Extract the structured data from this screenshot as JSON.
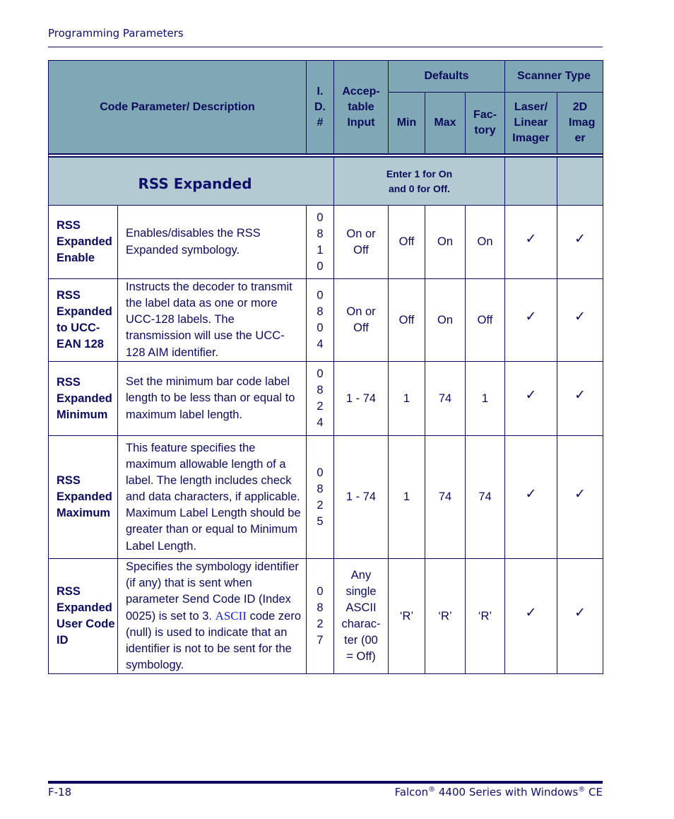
{
  "page": {
    "running_header": "Programming Parameters",
    "footer_page": "F-18",
    "footer_product_parts": [
      "Falcon",
      "®",
      " 4400 Series with Windows",
      "®",
      " CE"
    ]
  },
  "table": {
    "headers": {
      "code_param": "Code Parameter/ Description",
      "id": "I. D. #",
      "acceptable_input": "Accep- table Input",
      "defaults": "Defaults",
      "scanner_type": "Scanner Type",
      "min": "Min",
      "max": "Max",
      "factory": "Fac- tory",
      "laser": "Laser/ Linear Imager",
      "imager_2d": "2D Imag er"
    },
    "section": {
      "title": "RSS Expanded",
      "note_line1": "Enter 1 for On",
      "note_line2": "and 0 for Off."
    },
    "check_glyph": "✓",
    "rows": [
      {
        "name": "RSS Expanded Enable",
        "description_before": "Enables/disables the RSS Expanded symbology.",
        "description_ascii": "",
        "description_after": "",
        "id_digits": [
          "0",
          "8",
          "1",
          "0"
        ],
        "acceptable_input": "On or Off",
        "min": "Off",
        "max": "On",
        "factory": "On",
        "laser": true,
        "imager_2d": true
      },
      {
        "name": "RSS Expanded to UCC-EAN 128",
        "description_before": "Instructs the decoder to transmit the label data as one or more UCC-128 labels. The transmission will use the UCC-128 AIM identifier.",
        "description_ascii": "",
        "description_after": "",
        "id_digits": [
          "0",
          "8",
          "0",
          "4"
        ],
        "acceptable_input": "On or Off",
        "min": "Off",
        "max": "On",
        "factory": "Off",
        "laser": true,
        "imager_2d": true
      },
      {
        "name": "RSS Expanded Minimum",
        "description_before": "Set the minimum bar code label length to be less than or equal to maximum label length.",
        "description_ascii": "",
        "description_after": "",
        "id_digits": [
          "0",
          "8",
          "2",
          "4"
        ],
        "acceptable_input": "1 - 74",
        "min": "1",
        "max": "74",
        "factory": "1",
        "laser": true,
        "imager_2d": true
      },
      {
        "name": "RSS Expanded Maximum",
        "description_before": "This feature specifies the maximum allowable length of a label. The length includes check and data characters, if applicable. Maximum Label Length should be greater than or equal to Minimum Label Length.",
        "description_ascii": "",
        "description_after": "",
        "id_digits": [
          "0",
          "8",
          "2",
          "5"
        ],
        "acceptable_input": "1 - 74",
        "min": "1",
        "max": "74",
        "factory": "74",
        "laser": true,
        "imager_2d": true
      },
      {
        "name": "RSS Expanded User Code ID",
        "description_before": "Specifies the symbology identifier (if any) that is sent when parameter Send Code ID (Index 0025) is set to 3. ",
        "description_ascii": "ASCII",
        "description_after": " code zero (null) is used to indicate that an identifier is not to be sent for the symbology.",
        "id_digits": [
          "0",
          "8",
          "2",
          "7"
        ],
        "acceptable_input": "Any single ASCII charac- ter (00 = Off)",
        "min": "‘R’",
        "max": "‘R’",
        "factory": "‘R’",
        "laser": true,
        "imager_2d": true
      }
    ]
  }
}
